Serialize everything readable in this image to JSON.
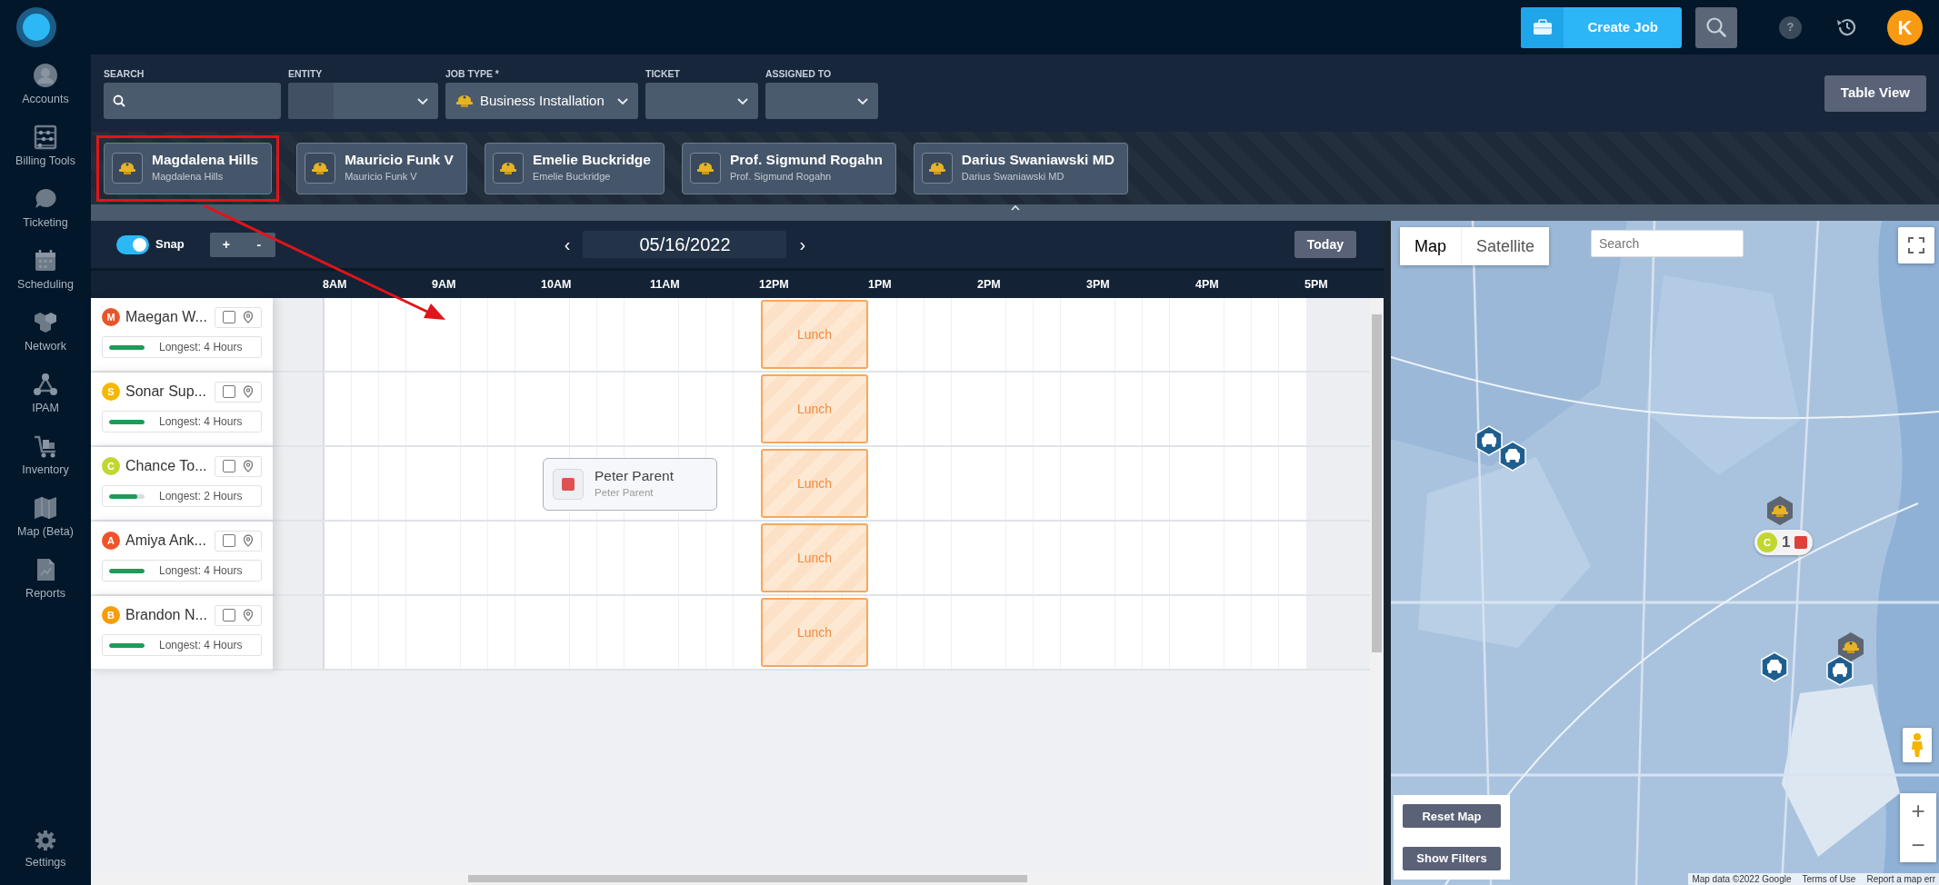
{
  "topbar": {
    "create_job": "Create Job",
    "help": "?",
    "avatar": "K"
  },
  "sidebar": {
    "items": [
      {
        "label": "Accounts"
      },
      {
        "label": "Billing Tools"
      },
      {
        "label": "Ticketing"
      },
      {
        "label": "Scheduling"
      },
      {
        "label": "Network"
      },
      {
        "label": "IPAM"
      },
      {
        "label": "Inventory"
      },
      {
        "label": "Map (Beta)"
      },
      {
        "label": "Reports"
      }
    ],
    "settings": "Settings"
  },
  "filters": [
    {
      "label": "SEARCH",
      "kind": "search"
    },
    {
      "label": "ENTITY",
      "kind": "split-select"
    },
    {
      "label": "JOB TYPE *",
      "kind": "select",
      "value": "Business Installation"
    },
    {
      "label": "TICKET",
      "kind": "select"
    },
    {
      "label": "ASSIGNED TO",
      "kind": "select"
    }
  ],
  "table_view": "Table View",
  "technicians": [
    {
      "name": "Magdalena Hills",
      "subtitle": "Magdalena Hills",
      "highlighted": true
    },
    {
      "name": "Mauricio Funk V",
      "subtitle": "Mauricio Funk V",
      "highlighted": false
    },
    {
      "name": "Emelie Buckridge",
      "subtitle": "Emelie Buckridge",
      "highlighted": false
    },
    {
      "name": "Prof. Sigmund Rogahn",
      "subtitle": "Prof. Sigmund Rogahn",
      "highlighted": false
    },
    {
      "name": "Darius Swaniawski MD",
      "subtitle": "Darius Swaniawski MD",
      "highlighted": false
    }
  ],
  "toolbar": {
    "snap": {
      "label": "Snap",
      "on": true
    },
    "zoom_in": "+",
    "zoom_out": "-",
    "prev": "‹",
    "date": "05/16/2022",
    "next": "›",
    "today": "Today"
  },
  "hours": [
    {
      "label": "8AM"
    },
    {
      "label": "9AM"
    },
    {
      "label": "10AM"
    },
    {
      "label": "11AM"
    },
    {
      "label": "12PM"
    },
    {
      "label": "1PM"
    },
    {
      "label": "2PM"
    },
    {
      "label": "3PM"
    },
    {
      "label": "4PM"
    },
    {
      "label": "5PM"
    }
  ],
  "resources": [
    {
      "initial": "M",
      "color": "#e8552b",
      "name": "Maegan W...",
      "checked": false,
      "level": 1,
      "longest": "Longest: 4 Hours",
      "events": [
        {
          "kind": "lunch",
          "label": "Lunch"
        }
      ]
    },
    {
      "initial": "S",
      "color": "#f5b800",
      "name": "Sonar Sup...",
      "checked": false,
      "level": 1,
      "longest": "Longest: 4 Hours",
      "events": [
        {
          "kind": "lunch",
          "label": "Lunch"
        }
      ]
    },
    {
      "initial": "C",
      "color": "#c2d630",
      "name": "Chance To...",
      "checked": false,
      "level": 0.8,
      "longest": "Longest: 2 Hours",
      "events": [
        {
          "kind": "job",
          "title": "Peter Parent",
          "subtitle": "Peter Parent",
          "color": "#e05252"
        },
        {
          "kind": "lunch",
          "label": "Lunch"
        }
      ]
    },
    {
      "initial": "A",
      "color": "#f0532b",
      "name": "Amiya Ank...",
      "checked": false,
      "level": 1,
      "longest": "Longest: 4 Hours",
      "events": [
        {
          "kind": "lunch",
          "label": "Lunch"
        }
      ]
    },
    {
      "initial": "B",
      "color": "#f59d0c",
      "name": "Brandon N...",
      "checked": false,
      "level": 1,
      "longest": "Longest: 4 Hours",
      "events": [
        {
          "kind": "lunch",
          "label": "Lunch"
        }
      ]
    }
  ],
  "map": {
    "tabs": [
      {
        "label": "Map",
        "selected": true
      },
      {
        "label": "Satellite",
        "selected": false
      }
    ],
    "search": {
      "placeholder": "Search"
    },
    "markers": [
      {
        "kind": "car"
      },
      {
        "kind": "car"
      },
      {
        "kind": "car"
      },
      {
        "kind": "car"
      },
      {
        "kind": "hat"
      },
      {
        "kind": "hat"
      }
    ],
    "cluster": {
      "initial": "C",
      "count": "1"
    },
    "zoom_in": "+",
    "zoom_out": "−",
    "buttons": [
      "Reset Map",
      "Show Filters"
    ],
    "footer": [
      "Map data ©2022 Google",
      "Terms of Use",
      "Report a map err"
    ]
  }
}
